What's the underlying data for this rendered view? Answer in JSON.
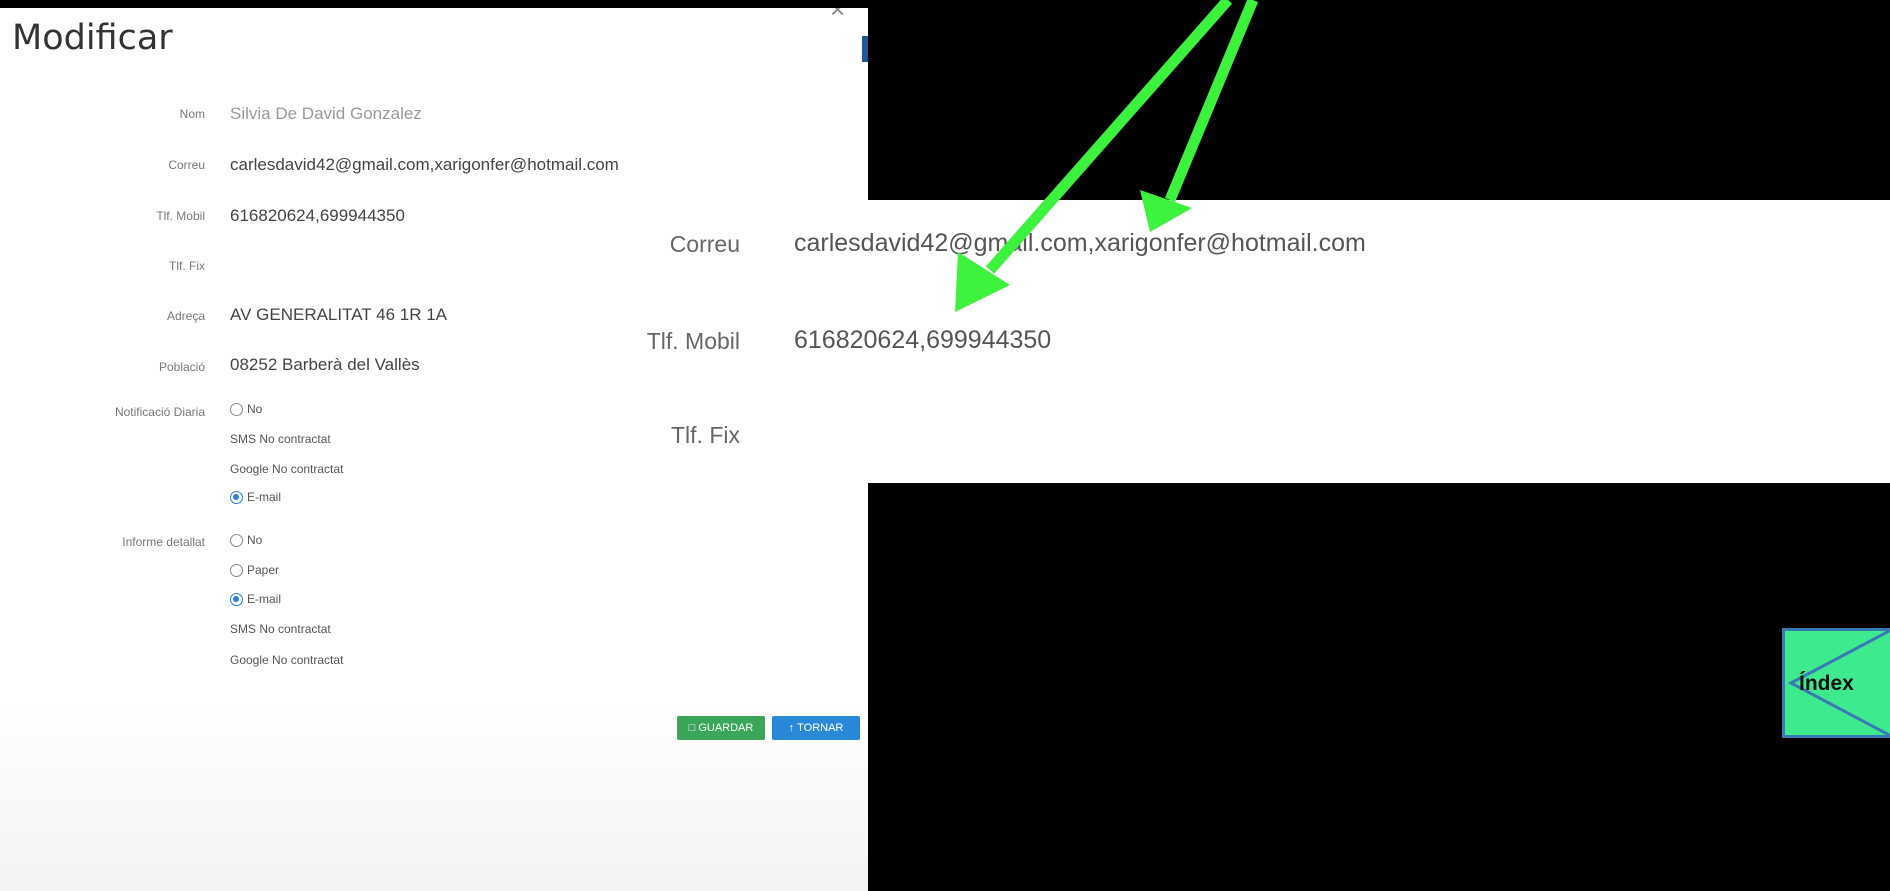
{
  "modal": {
    "title": "Modificar",
    "close": "×",
    "rows": [
      {
        "label": "Nom",
        "value": "Silvia De David Gonzalez"
      },
      {
        "label": "Correu",
        "value": "carlesdavid42@gmail.com,xarigonfer@hotmail.com"
      },
      {
        "label": "Tlf. Mobil",
        "value": "616820624,699944350"
      },
      {
        "label": "Tlf. Fix",
        "value": ""
      },
      {
        "label": "Adreça",
        "value": "AV GENERALITAT 46 1R 1A"
      },
      {
        "label": "Població",
        "value": "08252 Barberà del Vallès"
      }
    ],
    "notificacio": {
      "label": "Notificació Diaria",
      "options": [
        {
          "text": "No",
          "radio": true,
          "selected": false
        },
        {
          "text": "SMS No contractat",
          "radio": false
        },
        {
          "text": "Google No contractat",
          "radio": false
        },
        {
          "text": "E-mail",
          "radio": true,
          "selected": true
        }
      ]
    },
    "informe": {
      "label": "Informe detallat",
      "options": [
        {
          "text": "No",
          "radio": true,
          "selected": false
        },
        {
          "text": "Paper",
          "radio": true,
          "selected": false
        },
        {
          "text": "E-mail",
          "radio": true,
          "selected": true
        },
        {
          "text": "SMS No contractat",
          "radio": false
        },
        {
          "text": "Google No contractat",
          "radio": false
        }
      ]
    },
    "buttons": {
      "save": "GUARDAR",
      "back": "TORNAR"
    }
  },
  "zoom": {
    "rows": [
      {
        "label": "Correu",
        "value": "carlesdavid42@gmail.com,xarigonfer@hotmail.com"
      },
      {
        "label": "Tlf. Mobil",
        "value": "616820624,699944350"
      },
      {
        "label": "Tlf. Fix",
        "value": ""
      }
    ]
  },
  "index_button": {
    "label": "Índex"
  },
  "colors": {
    "arrow": "#3cf23c",
    "index_bg": "#3deb8e",
    "save": "#3aa65a",
    "back": "#2a88d8"
  }
}
